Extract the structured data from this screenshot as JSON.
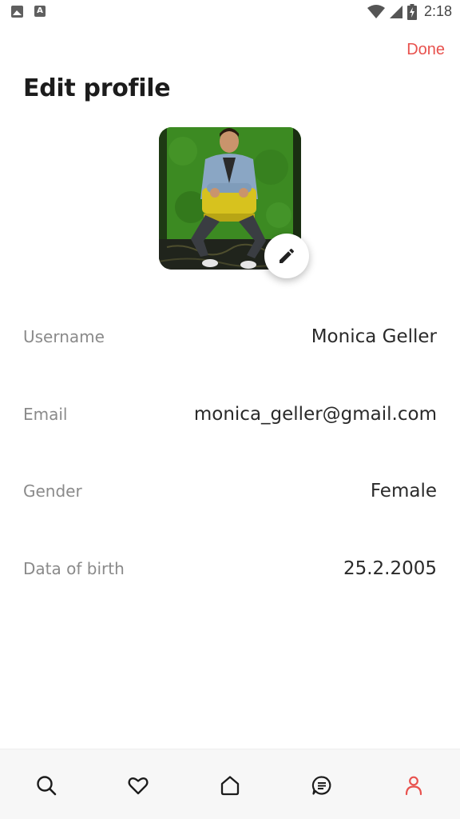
{
  "status_bar": {
    "time": "2:18",
    "left_icons": [
      "image-icon",
      "text-a-icon"
    ],
    "right_icons": [
      "wifi-icon",
      "signal-icon",
      "battery-charging-icon"
    ],
    "text_a": "A"
  },
  "header": {
    "done_label": "Done",
    "title": "Edit profile"
  },
  "profile_photo": {
    "edit_icon": "pencil-icon"
  },
  "fields": [
    {
      "label": "Username",
      "value": "Monica Geller"
    },
    {
      "label": "Email",
      "value": "monica_geller@gmail.com"
    },
    {
      "label": "Gender",
      "value": "Female"
    },
    {
      "label": "Data of birth",
      "value": "25.2.2005"
    }
  ],
  "bottom_nav": {
    "items": [
      "search-icon",
      "heart-icon",
      "home-icon",
      "chat-icon",
      "profile-icon"
    ],
    "active": "profile-icon"
  },
  "colors": {
    "accent": "#e8524e",
    "label": "#8a8a8a",
    "value": "#2a2a2a",
    "nav_background": "#f7f7f7"
  }
}
